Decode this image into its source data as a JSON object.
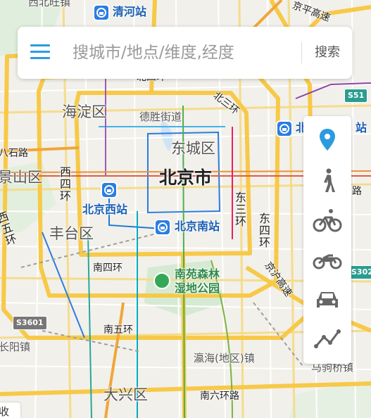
{
  "search": {
    "placeholder": "搜城市/地点/维度,经度",
    "button_label": "搜索",
    "menu_icon": "menu-icon"
  },
  "travel_modes": [
    {
      "name": "location",
      "icon": "location-pin-icon",
      "active": true
    },
    {
      "name": "walk",
      "icon": "walk-icon",
      "active": false
    },
    {
      "name": "bicycle",
      "icon": "bicycle-icon",
      "active": false
    },
    {
      "name": "motorcycle",
      "icon": "motorcycle-icon",
      "active": false
    },
    {
      "name": "car",
      "icon": "car-icon",
      "active": false
    },
    {
      "name": "route",
      "icon": "route-icon",
      "active": false
    }
  ],
  "colors": {
    "accent": "#2b9be0",
    "mode_icon": "#666666",
    "ring_road": "#f7c948",
    "rail_blue": "#2b7de1",
    "park_green": "#35a858"
  },
  "map_labels": {
    "city": "北京市",
    "districts": {
      "haidian": "海淀区",
      "dongcheng": "东城区",
      "fengtai": "丰台区",
      "shijingshan": "景山区",
      "daxing": "大兴区"
    },
    "roads": {
      "north_third_ring": "北三环",
      "west_fourth_ring": "西四环",
      "east_third_ring": "东三环",
      "east_fourth_ring": "东四环",
      "south_fourth_ring": "南四环",
      "south_fifth_ring": "南五环",
      "west_fifth_ring": "西五环",
      "south_sixth_ring": "南六环路",
      "jinghu_expressway": "京沪高速",
      "north_ring_top": "北四环",
      "top_right_expressway": "京平高速",
      "bashi_road": "八石路",
      "top_right_road": "路"
    },
    "streets": {
      "desheng": "德胜街道",
      "yinghai": "瀛海(地区)镇",
      "majuqiao": "马驹桥镇",
      "zhangliu": "长阳镇",
      "beiwang": "西北旺镇"
    },
    "stations": {
      "qinghe": "清河站",
      "beijing_west": "北京西站",
      "beijing_south": "北京南站",
      "beijing_east_partial": "北",
      "right_partial": "站"
    },
    "park": [
      "南苑森林",
      "湿地公园"
    ],
    "shields": [
      "S51",
      "S302",
      "S3601"
    ],
    "collapse_label": "收"
  }
}
